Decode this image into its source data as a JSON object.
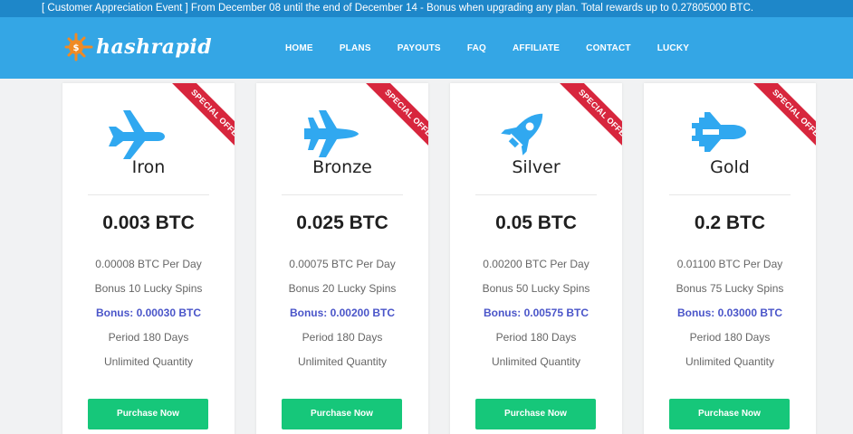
{
  "announcement": "[ Customer Appreciation Event ] From December 08 until the end of December 14 - Bonus when upgrading any plan. Total rewards up to 0.27805000 BTC.",
  "brand": {
    "name": "hashrapid",
    "icon": "dollar-gear-icon",
    "color": "#f08a24"
  },
  "nav": [
    "HOME",
    "PLANS",
    "PAYOUTS",
    "FAQ",
    "AFFILIATE",
    "CONTACT",
    "LUCKY"
  ],
  "colors": {
    "header": "#34a6e5",
    "announce": "#1e87c9",
    "icon": "#30a8f0",
    "ribbon": "#d7263d",
    "button": "#16c77a",
    "bonus": "#4a55c9"
  },
  "plans": [
    {
      "ribbon": "SPECIAL OFFER",
      "icon": "airplane-icon",
      "name": "Iron",
      "price": "0.003 BTC",
      "daily": "0.00008 BTC Per Day",
      "spins": "Bonus 10 Lucky Spins",
      "bonus": "Bonus: 0.00030 BTC",
      "period": "Period 180 Days",
      "quantity": "Unlimited Quantity",
      "button": "Purchase Now"
    },
    {
      "ribbon": "SPECIAL OFFER",
      "icon": "fighter-jet-icon",
      "name": "Bronze",
      "price": "0.025 BTC",
      "daily": "0.00075 BTC Per Day",
      "spins": "Bonus 20 Lucky Spins",
      "bonus": "Bonus: 0.00200 BTC",
      "period": "Period 180 Days",
      "quantity": "Unlimited Quantity",
      "button": "Purchase Now"
    },
    {
      "ribbon": "SPECIAL OFFER",
      "icon": "rocket-icon",
      "name": "Silver",
      "price": "0.05 BTC",
      "daily": "0.00200 BTC Per Day",
      "spins": "Bonus 50 Lucky Spins",
      "bonus": "Bonus: 0.00575 BTC",
      "period": "Period 180 Days",
      "quantity": "Unlimited Quantity",
      "button": "Purchase Now"
    },
    {
      "ribbon": "SPECIAL OFFER",
      "icon": "space-shuttle-icon",
      "name": "Gold",
      "price": "0.2 BTC",
      "daily": "0.01100 BTC Per Day",
      "spins": "Bonus 75 Lucky Spins",
      "bonus": "Bonus: 0.03000 BTC",
      "period": "Period 180 Days",
      "quantity": "Unlimited Quantity",
      "button": "Purchase Now"
    }
  ]
}
